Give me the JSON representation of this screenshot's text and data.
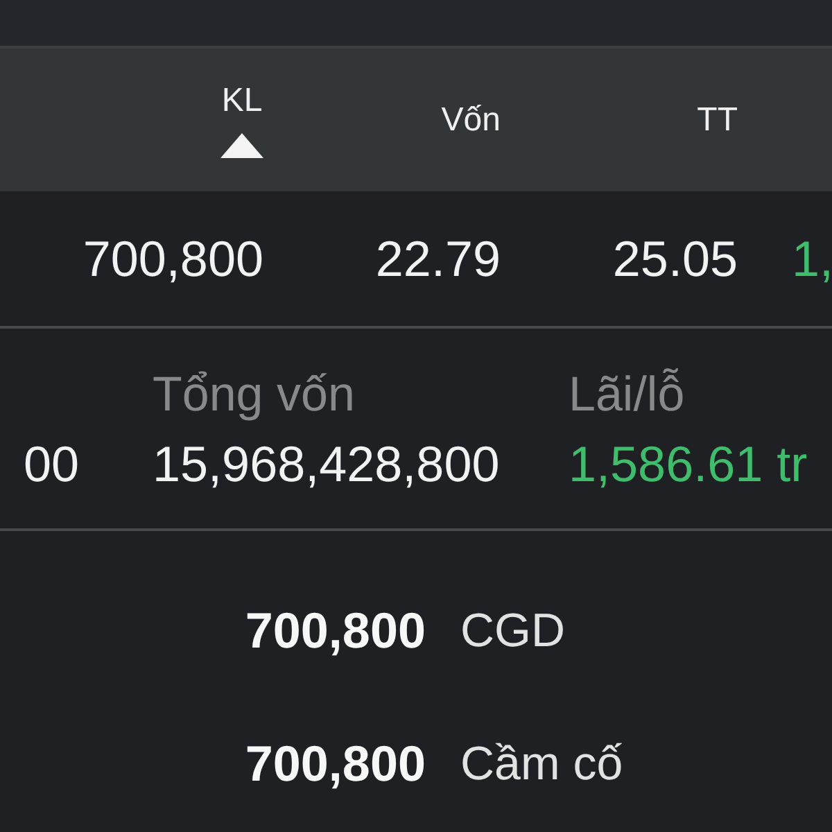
{
  "table": {
    "columns": [
      {
        "label": "KL",
        "sorted": true
      },
      {
        "label": "Vốn",
        "sorted": false
      },
      {
        "label": "TT",
        "sorted": false
      }
    ],
    "rows": [
      {
        "cells": [
          {
            "text": "700,800",
            "color": "#f2f2f2"
          },
          {
            "text": "22.79",
            "color": "#f2f2f2"
          },
          {
            "text": "25.05",
            "color": "#f2f2f2"
          },
          {
            "text": "1,",
            "color": "#3fbd6d"
          }
        ]
      }
    ]
  },
  "summary": {
    "items": [
      {
        "value": "00",
        "color": "#f2f2f2"
      },
      {
        "label": "Tổng vốn",
        "value": "15,968,428,800",
        "color": "#f2f2f2"
      },
      {
        "label": "Lãi/lỗ",
        "value": "1,586.61 tr",
        "color": "#3fbd6d"
      }
    ]
  },
  "holdings": [
    {
      "quantity": "700,800",
      "label": "CGD"
    },
    {
      "quantity": "700,800",
      "label": "Cầm cố"
    }
  ]
}
